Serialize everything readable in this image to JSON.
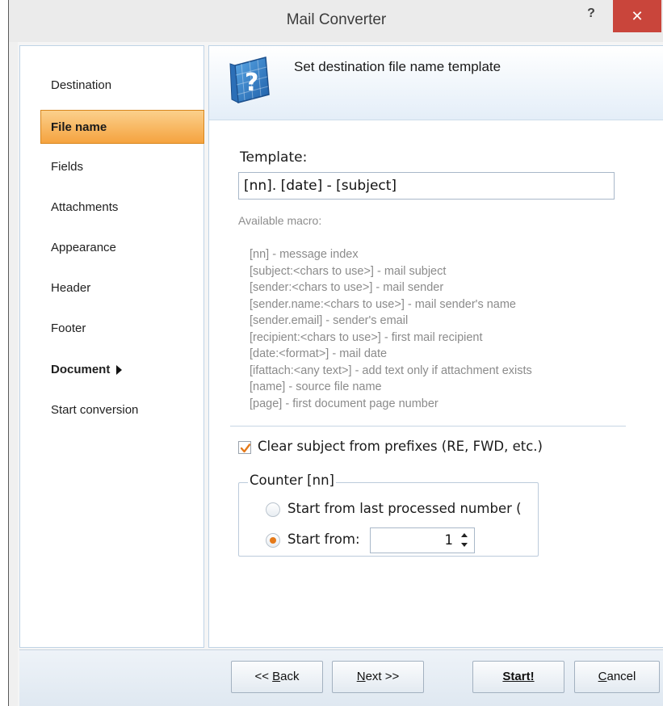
{
  "window": {
    "title": "Mail Converter",
    "help_label": "?",
    "close_label": "✕"
  },
  "sidebar": {
    "items": [
      {
        "label": "Destination"
      },
      {
        "label": "File name"
      },
      {
        "label": "Fields"
      },
      {
        "label": "Attachments"
      },
      {
        "label": "Appearance"
      },
      {
        "label": "Header"
      },
      {
        "label": "Footer"
      },
      {
        "label": "Document"
      },
      {
        "label": "Start conversion"
      }
    ]
  },
  "panel": {
    "header_title": "Set destination file name template",
    "template_label": "Template:",
    "template_value": "[nn]. [date] - [subject]",
    "macro_heading": "Available macro:",
    "macros": [
      "[nn] - message index",
      "[subject:<chars to use>] - mail subject",
      "[sender:<chars to use>] - mail sender",
      "[sender.name:<chars to use>] - mail sender's name",
      "[sender.email] - sender's email",
      "[recipient:<chars to use>] - first mail recipient",
      "[date:<format>] - mail date",
      "[ifattach:<any text>] - add text only if attachment exists",
      "[name] - source file name",
      "[page] - first document page number"
    ],
    "clear_subject_label": "Clear subject from prefixes (RE, FWD, etc.)",
    "clear_subject_checked": true,
    "counter": {
      "legend": "Counter [nn]",
      "option_last": "Start from last processed number (",
      "option_from": "Start from:",
      "start_value": "1",
      "selected": "start_from"
    }
  },
  "buttons": {
    "back_prefix": "<< ",
    "back_mnemonic": "B",
    "back_rest": "ack",
    "next_mnemonic": "N",
    "next_rest": "ext >>",
    "start_label": "Start!",
    "cancel_mnemonic": "C",
    "cancel_rest": "ancel"
  },
  "colors": {
    "active_item": "#f5a33f",
    "close_button": "#c9453b",
    "radio_selected": "#e57a1a",
    "check_mark": "#e57a1a"
  }
}
